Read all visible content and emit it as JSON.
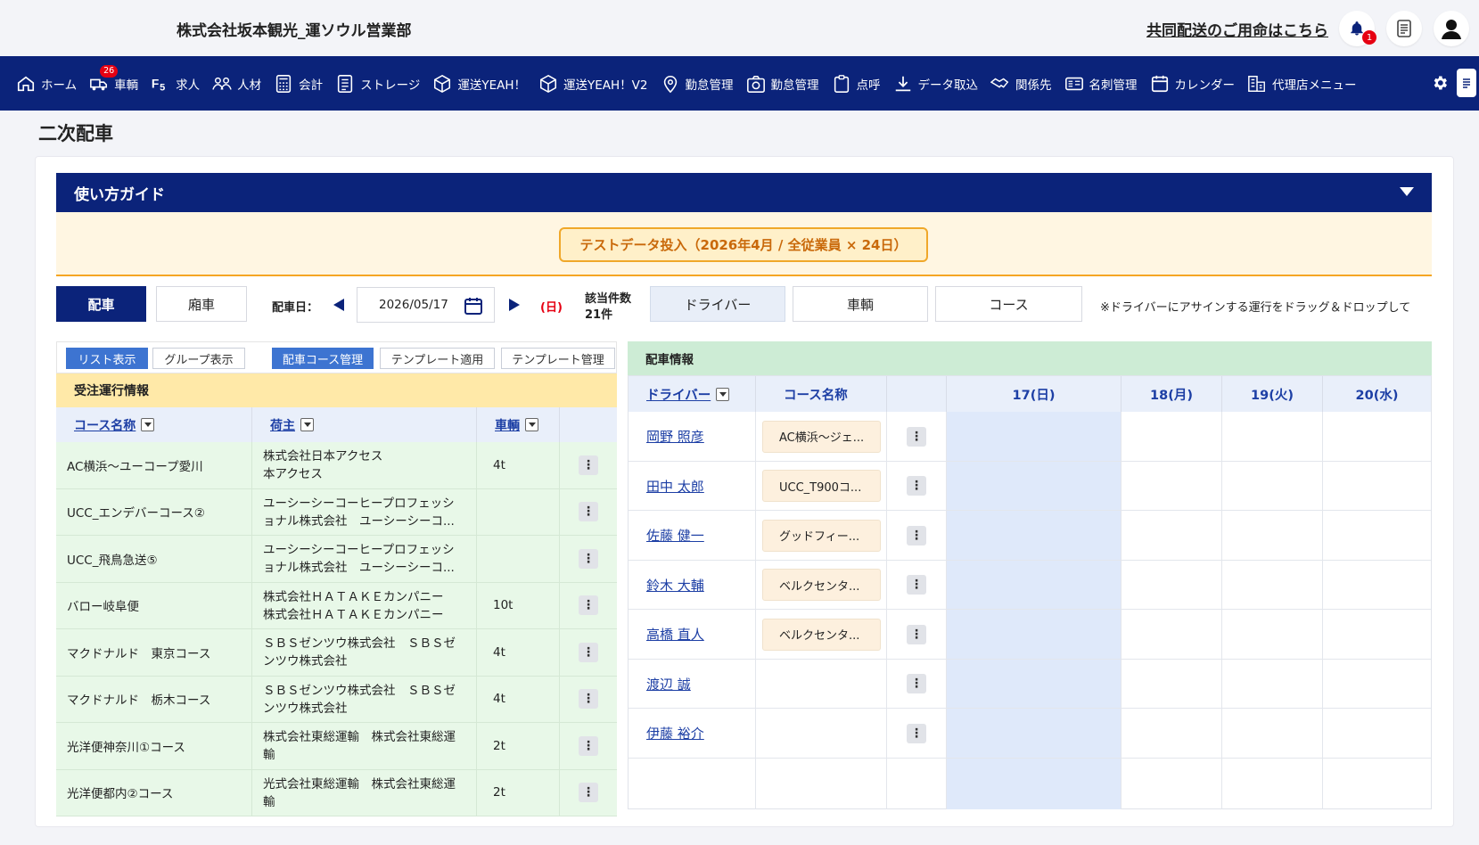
{
  "header": {
    "company": "株式会社坂本観光_運ソウル営業部",
    "shared_link": "共同配送のご用命はこちら",
    "notification_count": "1"
  },
  "nav": {
    "items": [
      {
        "label": "ホーム",
        "icon": "home-icon"
      },
      {
        "label": "車輌",
        "icon": "truck-icon",
        "badge": "26"
      },
      {
        "label": "求人",
        "icon": "job-icon"
      },
      {
        "label": "人材",
        "icon": "people-icon"
      },
      {
        "label": "会計",
        "icon": "calculator-icon"
      },
      {
        "label": "ストレージ",
        "icon": "document-icon"
      },
      {
        "label": "運送YEAH！",
        "icon": "box-icon"
      },
      {
        "label": "運送YEAH！V2",
        "icon": "box-icon"
      },
      {
        "label": "勤怠管理",
        "icon": "location-pin-icon"
      },
      {
        "label": "勤怠管理",
        "icon": "camera-icon"
      },
      {
        "label": "点呼",
        "icon": "clipboard-icon"
      },
      {
        "label": "データ取込",
        "icon": "download-icon"
      },
      {
        "label": "関係先",
        "icon": "handshake-icon"
      },
      {
        "label": "名刺管理",
        "icon": "business-card-icon"
      },
      {
        "label": "カレンダー",
        "icon": "calendar-icon"
      },
      {
        "label": "代理店メニュー",
        "icon": "agency-icon"
      }
    ]
  },
  "page": {
    "title": "二次配車",
    "guide": "使い方ガイド",
    "test_button": "テストデータ投入（2026年4月 / 全従業員 × 24日）"
  },
  "controls": {
    "dispatch": "配車",
    "cancel": "廂車",
    "date_label": "配車日：",
    "date": "2026/05/17",
    "weekday": "(日)",
    "count_label": "該当件数",
    "count": "21件",
    "tab_driver": "ドライバー",
    "tab_vehicle": "車輌",
    "tab_course": "コース",
    "note": "※ドライバーにアサインする運行をドラッグ＆ドロップして"
  },
  "left": {
    "view_list": "リスト表示",
    "view_group": "グループ表示",
    "course_mgmt": "配車コース管理",
    "template_apply": "テンプレート適用",
    "template_mgmt": "テンプレート管理",
    "section_title": "受注運行情報",
    "columns": [
      "コース名称",
      "荷主",
      "車輌"
    ],
    "rows": [
      {
        "course": "AC横浜～ユーコープ愛川",
        "shipper": "株式会社日本アクセス\n本アクセス",
        "vehicle": "4t"
      },
      {
        "course": "UCC_エンデバーコース②",
        "shipper": "ユーシーシーコーヒープロフェッシ\nョナル株式会社　ユーシーシーコ...",
        "vehicle": ""
      },
      {
        "course": "UCC_飛鳥急送⑤",
        "shipper": "ユーシーシーコーヒープロフェッシ\nョナル株式会社　ユーシーシーコ...",
        "vehicle": ""
      },
      {
        "course": "バロー岐阜便",
        "shipper": "株式会社ＨＡＴＡＫＥカンパニー\n株式会社ＨＡＴＡＫＥカンパニー",
        "vehicle": "10t"
      },
      {
        "course": "マクドナルド　東京コース",
        "shipper": "ＳＢＳゼンツウ株式会社　ＳＢＳゼ\nンツウ株式会社",
        "vehicle": "4t"
      },
      {
        "course": "マクドナルド　栃木コース",
        "shipper": "ＳＢＳゼンツウ株式会社　ＳＢＳゼ\nンツウ株式会社",
        "vehicle": "4t"
      },
      {
        "course": "光洋便神奈川①コース",
        "shipper": "株式会社東総運輸　株式会社東総運\n輸",
        "vehicle": "2t"
      },
      {
        "course": "光洋便都内②コース",
        "shipper": "光式会社東総運輸　株式会社東総運\n輸",
        "vehicle": "2t"
      }
    ]
  },
  "right": {
    "section_title": "配車情報",
    "col_driver": "ドライバー",
    "col_course": "コース名称",
    "days": [
      "17(日)",
      "18(月)",
      "19(火)",
      "20(水)"
    ],
    "rows": [
      {
        "driver": "岡野 照彦",
        "course": "AC横浜～ジェ..."
      },
      {
        "driver": "田中 太郎",
        "course": "UCC_T900コ..."
      },
      {
        "driver": "佐藤 健一",
        "course": "グッドフィー..."
      },
      {
        "driver": "鈴木 大輔",
        "course": "ベルクセンタ..."
      },
      {
        "driver": "高橋 直人",
        "course": "ベルクセンタ..."
      },
      {
        "driver": "渡辺 誠",
        "course": ""
      },
      {
        "driver": "伊藤 裕介",
        "course": ""
      }
    ]
  },
  "colors": {
    "navy": "#0b237a",
    "accent_orange": "#f0a82a",
    "link_blue": "#1d3fa5",
    "row_green": "#e8f8e8",
    "today_blue": "#dfe9fa"
  }
}
